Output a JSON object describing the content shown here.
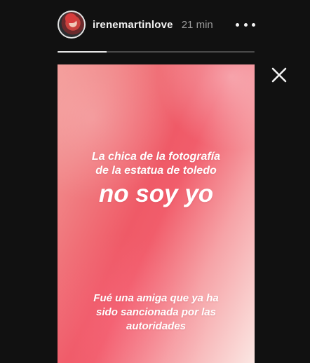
{
  "header": {
    "username": "irenemartinlove",
    "timestamp": "21 min",
    "more_icon": "more-horizontal-icon"
  },
  "progress": {
    "value": 0.25
  },
  "close_icon": "close-icon",
  "story": {
    "line1": "La chica de la fotografía",
    "line2": "de la estatua de toledo",
    "headline": "no soy yo",
    "footer_line1": "Fué una amiga que ya ha",
    "footer_line2": "sido sancionada por las",
    "footer_line3": "autoridades"
  },
  "colors": {
    "background": "#111111",
    "text_primary": "#f2f2f2",
    "text_secondary": "#9a9a9a",
    "story_gradient_start": "#f39a97",
    "story_gradient_mid": "#ef5a67",
    "story_gradient_end": "#fbe7e3"
  }
}
